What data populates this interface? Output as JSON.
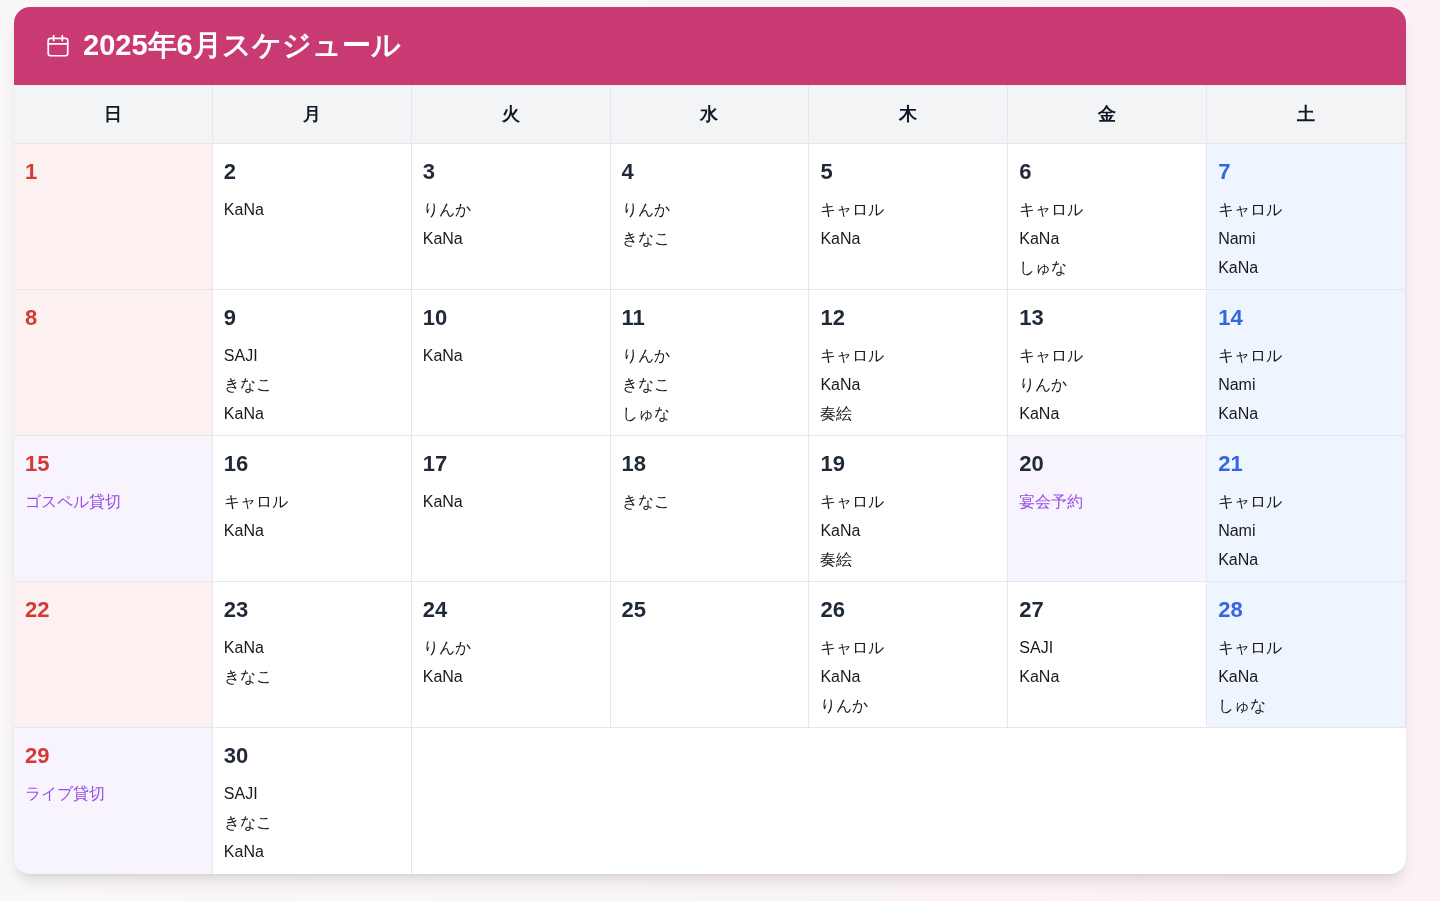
{
  "title": "2025年6月スケジュール",
  "weekdays": [
    {
      "label": "日"
    },
    {
      "label": "月"
    },
    {
      "label": "火"
    },
    {
      "label": "水"
    },
    {
      "label": "木"
    },
    {
      "label": "金"
    },
    {
      "label": "土"
    }
  ],
  "weeks": [
    [
      {
        "date": "1",
        "kind": "sunday"
      },
      {
        "date": "2",
        "kind": "weekday",
        "entries": [
          {
            "kind": "staff",
            "text": "KaNa"
          }
        ]
      },
      {
        "date": "3",
        "kind": "weekday",
        "entries": [
          {
            "kind": "staff",
            "text": "りんか"
          },
          {
            "kind": "staff",
            "text": "KaNa"
          }
        ]
      },
      {
        "date": "4",
        "kind": "weekday",
        "entries": [
          {
            "kind": "staff",
            "text": "りんか"
          },
          {
            "kind": "staff",
            "text": "きなこ"
          }
        ]
      },
      {
        "date": "5",
        "kind": "weekday",
        "entries": [
          {
            "kind": "staff",
            "text": "キャロル"
          },
          {
            "kind": "staff",
            "text": "KaNa"
          }
        ]
      },
      {
        "date": "6",
        "kind": "weekday",
        "entries": [
          {
            "kind": "staff",
            "text": "キャロル"
          },
          {
            "kind": "staff",
            "text": "KaNa"
          },
          {
            "kind": "staff",
            "text": "しゅな"
          }
        ]
      },
      {
        "date": "7",
        "kind": "saturday",
        "entries": [
          {
            "kind": "staff",
            "text": "キャロル"
          },
          {
            "kind": "staff",
            "text": "Nami"
          },
          {
            "kind": "staff",
            "text": "KaNa"
          }
        ]
      }
    ],
    [
      {
        "date": "8",
        "kind": "sunday"
      },
      {
        "date": "9",
        "kind": "weekday",
        "entries": [
          {
            "kind": "staff",
            "text": "SAJI"
          },
          {
            "kind": "staff",
            "text": "きなこ"
          },
          {
            "kind": "staff",
            "text": "KaNa"
          }
        ]
      },
      {
        "date": "10",
        "kind": "weekday",
        "entries": [
          {
            "kind": "staff",
            "text": "KaNa"
          }
        ]
      },
      {
        "date": "11",
        "kind": "weekday",
        "entries": [
          {
            "kind": "staff",
            "text": "りんか"
          },
          {
            "kind": "staff",
            "text": "きなこ"
          },
          {
            "kind": "staff",
            "text": "しゅな"
          }
        ]
      },
      {
        "date": "12",
        "kind": "weekday",
        "entries": [
          {
            "kind": "staff",
            "text": "キャロル"
          },
          {
            "kind": "staff",
            "text": "KaNa"
          },
          {
            "kind": "staff",
            "text": "奏絵"
          }
        ]
      },
      {
        "date": "13",
        "kind": "weekday",
        "entries": [
          {
            "kind": "staff",
            "text": "キャロル"
          },
          {
            "kind": "staff",
            "text": "りんか"
          },
          {
            "kind": "staff",
            "text": "KaNa"
          }
        ]
      },
      {
        "date": "14",
        "kind": "saturday",
        "entries": [
          {
            "kind": "staff",
            "text": "キャロル"
          },
          {
            "kind": "staff",
            "text": "Nami"
          },
          {
            "kind": "staff",
            "text": "KaNa"
          }
        ]
      }
    ],
    [
      {
        "date": "15",
        "kind": "sunday",
        "entries": [
          {
            "kind": "event",
            "text": "ゴスペル貸切"
          }
        ]
      },
      {
        "date": "16",
        "kind": "weekday",
        "entries": [
          {
            "kind": "staff",
            "text": "キャロル"
          },
          {
            "kind": "staff",
            "text": "KaNa"
          }
        ]
      },
      {
        "date": "17",
        "kind": "weekday",
        "entries": [
          {
            "kind": "staff",
            "text": "KaNa"
          }
        ]
      },
      {
        "date": "18",
        "kind": "weekday",
        "entries": [
          {
            "kind": "staff",
            "text": "きなこ"
          }
        ]
      },
      {
        "date": "19",
        "kind": "weekday",
        "entries": [
          {
            "kind": "staff",
            "text": "キャロル"
          },
          {
            "kind": "staff",
            "text": "KaNa"
          },
          {
            "kind": "staff",
            "text": "奏絵"
          }
        ]
      },
      {
        "date": "20",
        "kind": "weekday",
        "entries": [
          {
            "kind": "event",
            "text": "宴会予約"
          }
        ]
      },
      {
        "date": "21",
        "kind": "saturday",
        "entries": [
          {
            "kind": "staff",
            "text": "キャロル"
          },
          {
            "kind": "staff",
            "text": "Nami"
          },
          {
            "kind": "staff",
            "text": "KaNa"
          }
        ]
      }
    ],
    [
      {
        "date": "22",
        "kind": "sunday"
      },
      {
        "date": "23",
        "kind": "weekday",
        "entries": [
          {
            "kind": "staff",
            "text": "KaNa"
          },
          {
            "kind": "staff",
            "text": "きなこ"
          }
        ]
      },
      {
        "date": "24",
        "kind": "weekday",
        "entries": [
          {
            "kind": "staff",
            "text": "りんか"
          },
          {
            "kind": "staff",
            "text": "KaNa"
          }
        ]
      },
      {
        "date": "25",
        "kind": "weekday"
      },
      {
        "date": "26",
        "kind": "weekday",
        "entries": [
          {
            "kind": "staff",
            "text": "キャロル"
          },
          {
            "kind": "staff",
            "text": "KaNa"
          },
          {
            "kind": "staff",
            "text": "りんか"
          }
        ]
      },
      {
        "date": "27",
        "kind": "weekday",
        "entries": [
          {
            "kind": "staff",
            "text": "SAJI"
          },
          {
            "kind": "staff",
            "text": "KaNa"
          }
        ]
      },
      {
        "date": "28",
        "kind": "saturday",
        "entries": [
          {
            "kind": "staff",
            "text": "キャロル"
          },
          {
            "kind": "staff",
            "text": "KaNa"
          },
          {
            "kind": "staff",
            "text": "しゅな"
          }
        ]
      }
    ],
    [
      {
        "date": "29",
        "kind": "sunday",
        "entries": [
          {
            "kind": "event",
            "text": "ライブ貸切"
          }
        ]
      },
      {
        "date": "30",
        "kind": "weekday",
        "entries": [
          {
            "kind": "staff",
            "text": "SAJI"
          },
          {
            "kind": "staff",
            "text": "きなこ"
          },
          {
            "kind": "staff",
            "text": "KaNa"
          }
        ]
      }
    ]
  ]
}
